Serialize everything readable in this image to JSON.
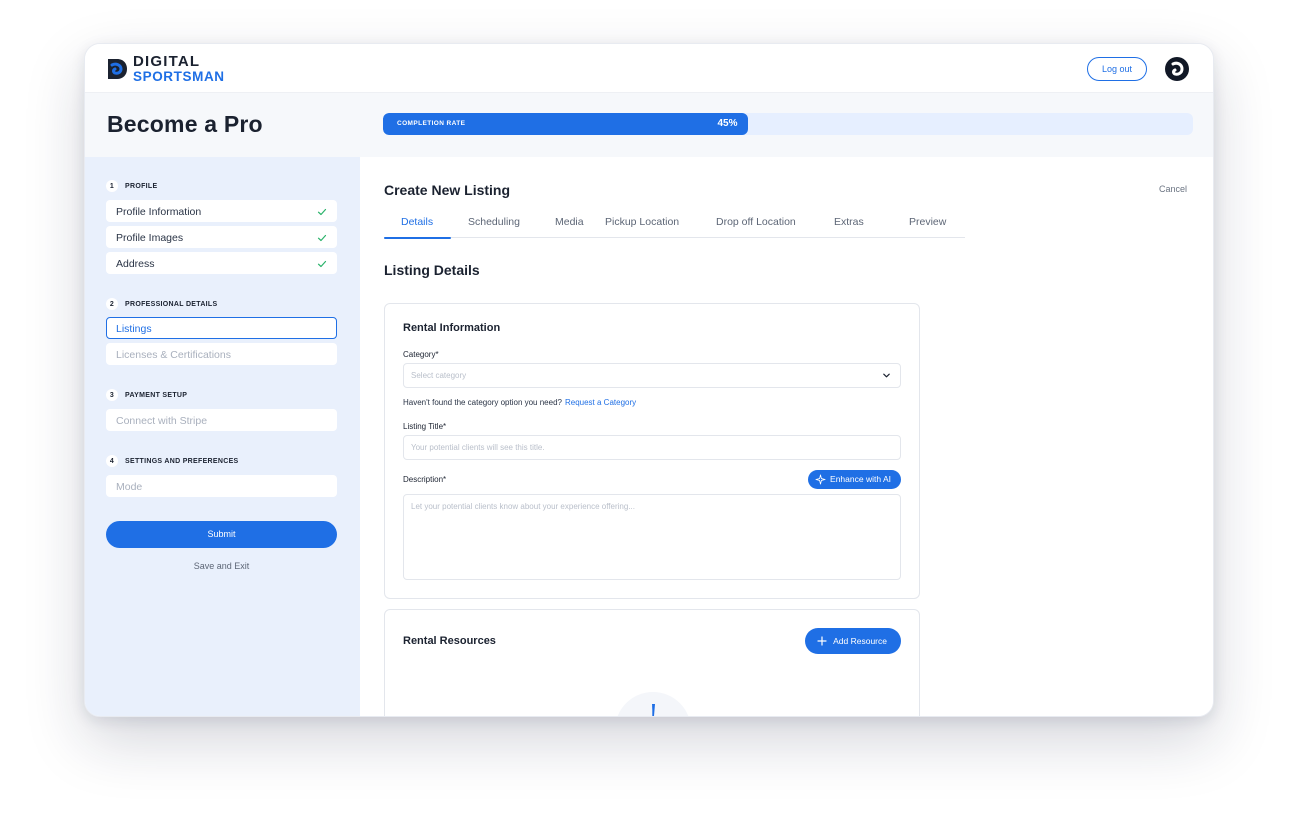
{
  "app": {
    "logo_line1": "DIGITAL",
    "logo_line2": "SPORTSMAN",
    "logout_label": "Log out"
  },
  "header": {
    "title": "Become a Pro",
    "progress_label": "COMPLETION RATE",
    "progress_value": "45%",
    "progress_fraction": 0.45
  },
  "sidebar": {
    "sections": [
      {
        "num": "1",
        "label": "PROFILE"
      },
      {
        "num": "2",
        "label": "PROFESSIONAL DETAILS"
      },
      {
        "num": "3",
        "label": "PAYMENT SETUP"
      },
      {
        "num": "4",
        "label": "SETTINGS AND PREFERENCES"
      }
    ],
    "items": [
      {
        "label": "Profile Information",
        "status": "complete"
      },
      {
        "label": "Profile Images",
        "status": "complete"
      },
      {
        "label": "Address",
        "status": "complete"
      },
      {
        "label": "Listings",
        "status": "active"
      },
      {
        "label": "Licenses & Certifications",
        "status": "pending"
      },
      {
        "label": "Connect with Stripe",
        "status": "pending"
      },
      {
        "label": "Mode",
        "status": "pending"
      }
    ],
    "submit_label": "Submit",
    "save_exit_label": "Save and Exit"
  },
  "main": {
    "title": "Create New Listing",
    "cancel_label": "Cancel",
    "tabs": [
      {
        "label": "Details",
        "active": true
      },
      {
        "label": "Scheduling"
      },
      {
        "label": "Media"
      },
      {
        "label": "Pickup Location"
      },
      {
        "label": "Drop off Location"
      },
      {
        "label": "Extras"
      },
      {
        "label": "Preview"
      }
    ],
    "section_title": "Listing Details",
    "rental_info": {
      "title": "Rental Information",
      "category_label": "Category",
      "category_placeholder": "Select category",
      "helper_text": "Haven't found the category option you need?",
      "helper_link": "Request a Category",
      "title_label": "Listing Title",
      "title_placeholder": "Your potential clients will see this title.",
      "description_label": "Description",
      "description_placeholder": "Let your potential clients know about your experience offering...",
      "required_mark": "*",
      "enhance_label": "Enhance with AI"
    },
    "rental_resources": {
      "title": "Rental Resources",
      "add_label": "Add Resource"
    }
  },
  "colors": {
    "accent": "#1f6fe5",
    "sidebar_bg": "#e9f0fc",
    "success": "#2bb36b"
  }
}
